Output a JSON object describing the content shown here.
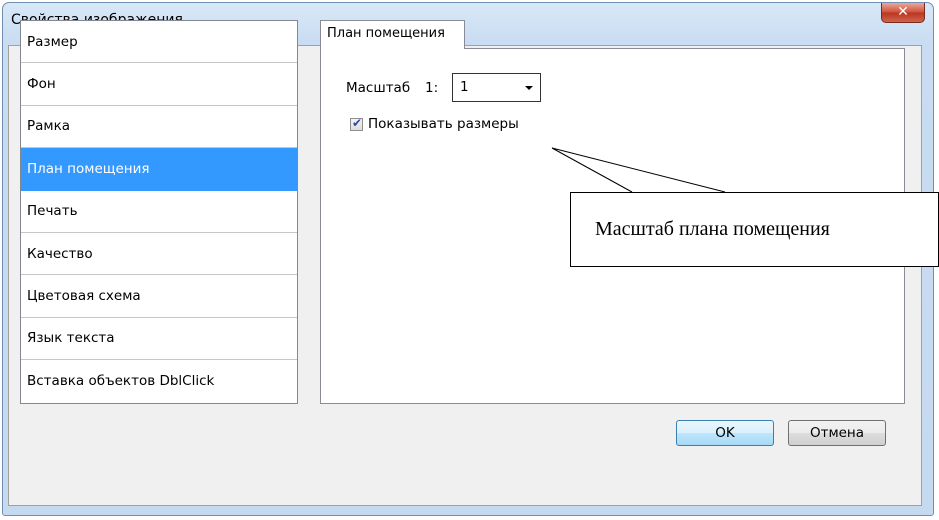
{
  "window": {
    "title": "Свойства изображения",
    "close_glyph": "✕"
  },
  "sidebar": {
    "items": [
      {
        "label": "Размер"
      },
      {
        "label": "Фон"
      },
      {
        "label": "Рамка"
      },
      {
        "label": "План помещения",
        "selected": true
      },
      {
        "label": "Печать"
      },
      {
        "label": "Качество"
      },
      {
        "label": "Цветовая схема"
      },
      {
        "label": "Язык текста"
      },
      {
        "label": "Вставка объектов DblClick"
      }
    ]
  },
  "tab": {
    "label": "План помещения"
  },
  "scale": {
    "label": "Масштаб",
    "prefix": "1:",
    "value": "1"
  },
  "show_sizes": {
    "label": "Показывать размеры",
    "checked": true
  },
  "buttons": {
    "ok": "OK",
    "cancel": "Отмена"
  },
  "callout": {
    "text": "Масштаб плана помещения"
  },
  "colors": {
    "selection": "#3399ff",
    "close_button": "#cf4f3a"
  }
}
